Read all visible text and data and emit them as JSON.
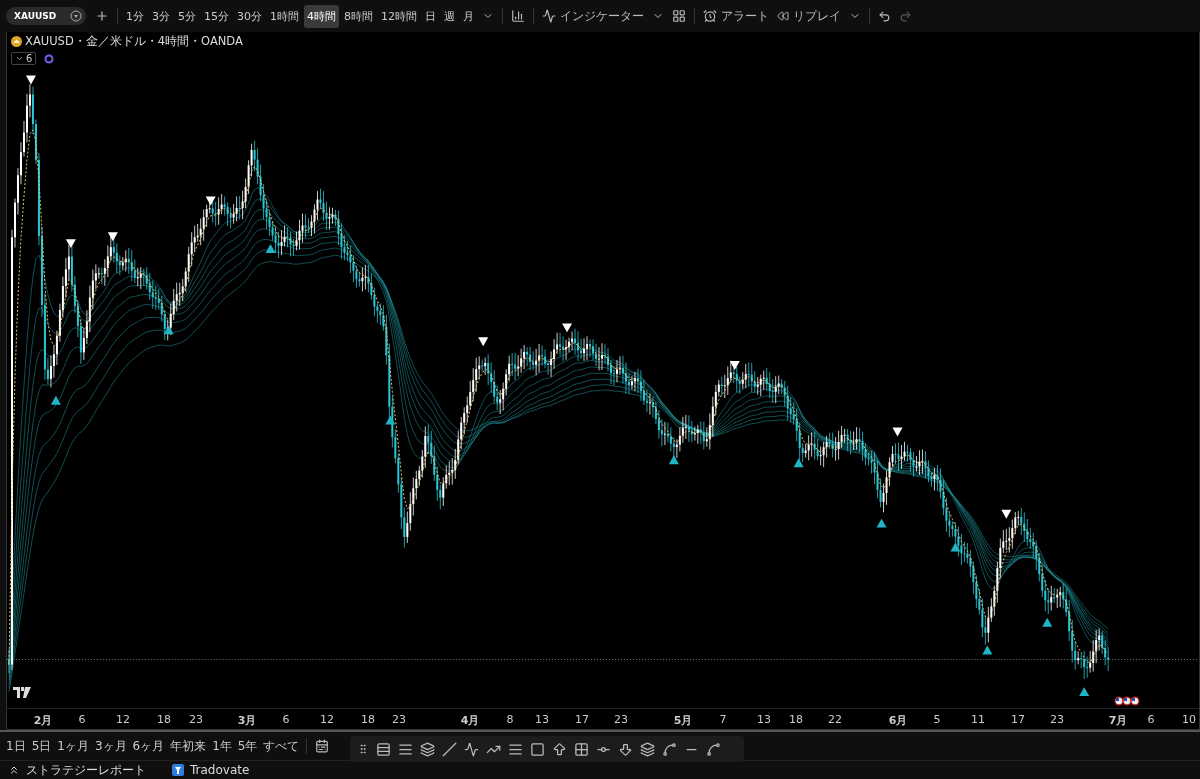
{
  "toolbar": {
    "symbol": "XAUUSD",
    "intervals": [
      {
        "label": "1分",
        "selected": false
      },
      {
        "label": "3分",
        "selected": false
      },
      {
        "label": "5分",
        "selected": false
      },
      {
        "label": "15分",
        "selected": false
      },
      {
        "label": "30分",
        "selected": false
      },
      {
        "label": "1時間",
        "selected": false
      },
      {
        "label": "4時間",
        "selected": true
      },
      {
        "label": "8時間",
        "selected": false
      },
      {
        "label": "12時間",
        "selected": false
      },
      {
        "label": "日",
        "selected": false
      },
      {
        "label": "週",
        "selected": false
      },
      {
        "label": "月",
        "selected": false
      }
    ],
    "indicators": "インジケーター",
    "alert": "アラート",
    "replay": "リプレイ"
  },
  "legend": {
    "title": "XAUUSD・金／米ドル・4時間・OANDA",
    "collapse_count": "6"
  },
  "time_axis": [
    {
      "label": "2月",
      "kind": "month"
    },
    {
      "label": "6",
      "kind": "day"
    },
    {
      "label": "12",
      "kind": "day"
    },
    {
      "label": "18",
      "kind": "day"
    },
    {
      "label": "23",
      "kind": "day"
    },
    {
      "label": "3月",
      "kind": "month"
    },
    {
      "label": "6",
      "kind": "day"
    },
    {
      "label": "12",
      "kind": "day"
    },
    {
      "label": "18",
      "kind": "day"
    },
    {
      "label": "23",
      "kind": "day"
    },
    {
      "label": "4月",
      "kind": "month"
    },
    {
      "label": "8",
      "kind": "day"
    },
    {
      "label": "13",
      "kind": "day"
    },
    {
      "label": "17",
      "kind": "day"
    },
    {
      "label": "23",
      "kind": "day"
    },
    {
      "label": "5月",
      "kind": "month"
    },
    {
      "label": "7",
      "kind": "day"
    },
    {
      "label": "13",
      "kind": "day"
    },
    {
      "label": "18",
      "kind": "day"
    },
    {
      "label": "22",
      "kind": "day"
    },
    {
      "label": "6月",
      "kind": "month"
    },
    {
      "label": "5",
      "kind": "day"
    },
    {
      "label": "11",
      "kind": "day"
    },
    {
      "label": "17",
      "kind": "day"
    },
    {
      "label": "23",
      "kind": "day"
    },
    {
      "label": "7月",
      "kind": "month"
    },
    {
      "label": "6",
      "kind": "day"
    },
    {
      "label": "10",
      "kind": "day"
    }
  ],
  "ranges": [
    "1日",
    "5日",
    "1ヶ月",
    "3ヶ月",
    "6ヶ月",
    "年初来",
    "1年",
    "5年",
    "すべて"
  ],
  "footer": [
    {
      "label": "ストラテジーレポート",
      "kind": "report"
    },
    {
      "label": "Tradovate",
      "kind": "broker"
    }
  ]
}
